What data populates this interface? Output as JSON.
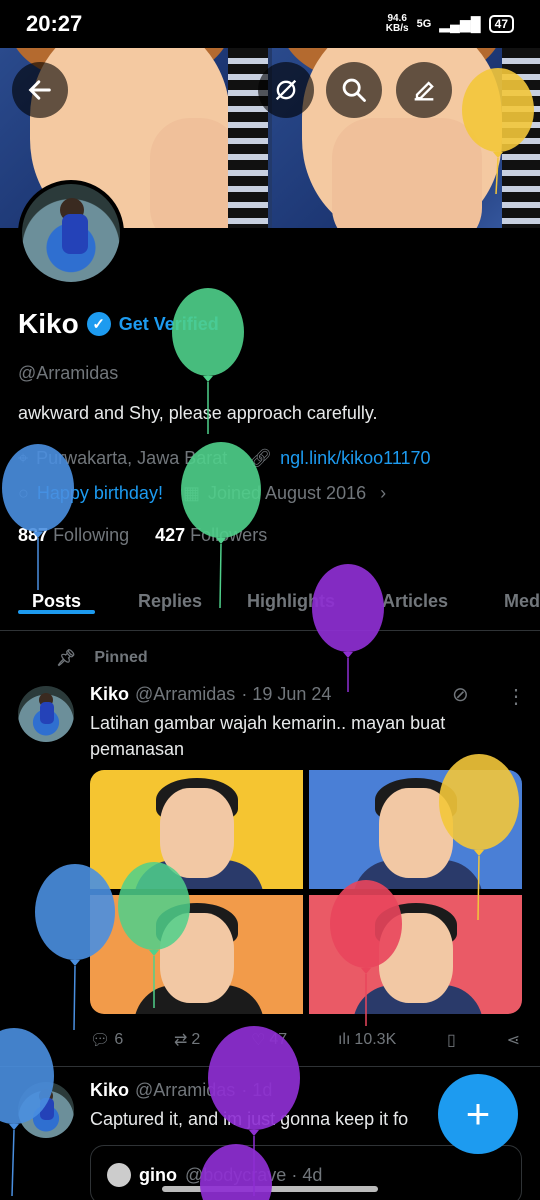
{
  "status_bar": {
    "time": "20:27",
    "net_speed": "94.6",
    "net_unit": "KB/s",
    "signal": "5G",
    "battery": "47"
  },
  "header": {
    "back_icon": "arrow-left-icon",
    "grok_icon": "slash-circle-icon",
    "search_icon": "search-icon",
    "compose_icon": "edit-icon"
  },
  "profile": {
    "name": "Kiko",
    "get_verified": "Get Verified",
    "handle": "@Arramidas",
    "bio": "awkward and Shy, please approach carefully.",
    "location": "Purwakarta, Jawa Barat",
    "link": "ngl.link/kikoo11170",
    "birthday": "Happy birthday!",
    "joined": "Joined August 2016",
    "following_count": "887",
    "following_label": "Following",
    "followers_count": "427",
    "followers_label": "Followers"
  },
  "tabs": [
    {
      "label": "Posts",
      "active": true
    },
    {
      "label": "Replies"
    },
    {
      "label": "Highlights"
    },
    {
      "label": "Articles"
    },
    {
      "label": "Med"
    }
  ],
  "pinned_label": "Pinned",
  "tweets": [
    {
      "author": "Kiko",
      "handle": "@Arramidas",
      "date": "· 19 Jun 24",
      "text": "Latihan gambar wajah kemarin.. mayan buat pemanasan",
      "grid_colors": [
        "#f5c531",
        "#4a7fd6",
        "#f29b4a",
        "#ea5a66"
      ],
      "replies": "6",
      "reposts": "2",
      "likes": "47",
      "views": "10.3K"
    },
    {
      "author": "Kiko",
      "handle": "@Arramidas",
      "date": "· 1d",
      "text": "Captured it, and im just gonna keep it fo",
      "quote_author": "gino",
      "quote_handle": "@bodycrave · 4d"
    }
  ],
  "fab_label": "+",
  "balloon_colors": {
    "yellow": "#f3c63a",
    "green": "#4fd08b",
    "blue": "#4a8fe0",
    "purple": "#8e2fd2",
    "red": "#e9455c"
  }
}
